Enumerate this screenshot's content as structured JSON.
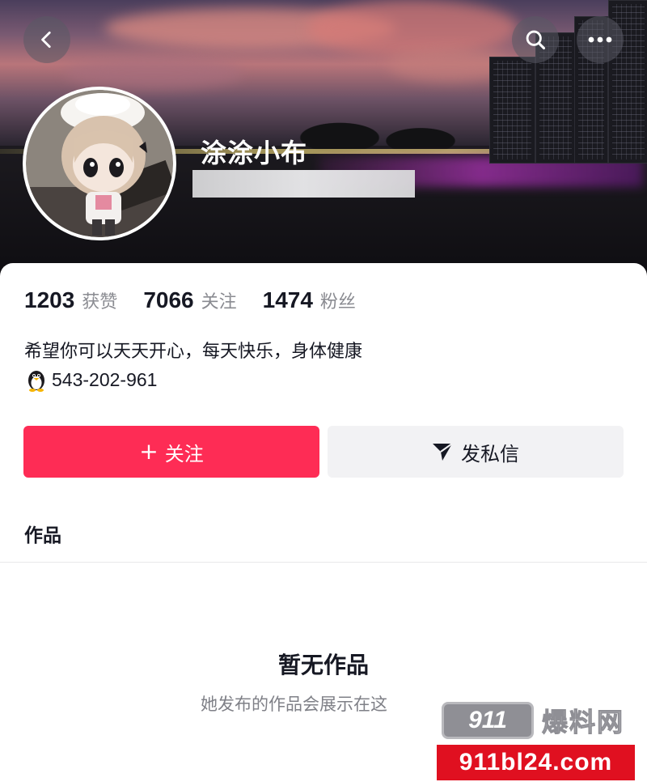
{
  "profile": {
    "username": "涂涂小布",
    "bio": "希望你可以天天开心，每天快乐，身体健康",
    "qq_number": "543-202-961"
  },
  "stats": [
    {
      "value": "1203",
      "label": "获赞"
    },
    {
      "value": "7066",
      "label": "关注"
    },
    {
      "value": "1474",
      "label": "粉丝"
    }
  ],
  "actions": {
    "follow_label": "关注",
    "follow_plus": "+",
    "message_label": "发私信"
  },
  "tabs": {
    "works_label": "作品"
  },
  "empty_state": {
    "title": "暂无作品",
    "subtitle": "她发布的作品会展示在这"
  },
  "watermark": {
    "logo_text": "911",
    "brand": "爆料网",
    "url": "911bl24.com"
  },
  "colors": {
    "accent": "#fe2c55",
    "secondary_button": "#f2f2f4",
    "text_primary": "#161823",
    "text_secondary": "#8a8b91"
  },
  "icons": {
    "back": "chevron-left-icon",
    "search": "search-icon",
    "more": "more-horizontal-icon",
    "message": "send-icon",
    "qq": "penguin-icon"
  }
}
